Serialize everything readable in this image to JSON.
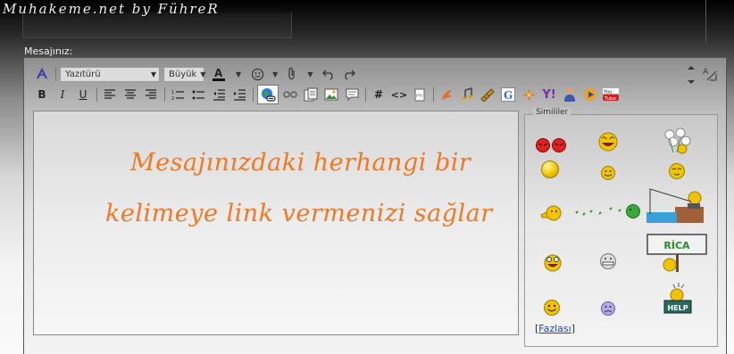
{
  "watermark": "Muhakeme.net by FühreR",
  "form": {
    "message_label": "Mesajınız:"
  },
  "toolbar": {
    "font_family": "Yazıtürü",
    "font_size": "Büyük",
    "row1_icons": [
      "font-color-icon",
      "smiley-menu-icon",
      "attach-icon",
      "undo-icon",
      "redo-icon"
    ],
    "row2_icons": [
      "bold-icon",
      "italic-icon",
      "underline-icon",
      "align-left-icon",
      "align-center-icon",
      "align-right-icon",
      "ordered-list-icon",
      "unordered-list-icon",
      "outdent-icon",
      "indent-icon",
      "insert-link-icon",
      "unlink-icon",
      "insert-email-icon",
      "insert-image-icon",
      "quote-icon",
      "code-hash-icon",
      "html-code-icon",
      "php-code-icon",
      "flash-icon",
      "music-icon",
      "video-icon",
      "google-icon",
      "star-icon",
      "yahoo-icon",
      "mspaint-icon",
      "media-player-icon",
      "youtube-icon"
    ],
    "active_tool": "insert-link-icon"
  },
  "editor": {
    "overlay_lines": [
      "Mesajınızdaki herhangi bir",
      "kelimeye link vermenizi sağlar"
    ],
    "overlay_color": "#f07820"
  },
  "smilies": {
    "legend": "Simililer",
    "rica_sign": "RİCA",
    "help_sign": "HELP",
    "more_prefix": "[",
    "more_link": "Fazlası",
    "more_suffix": "]"
  }
}
